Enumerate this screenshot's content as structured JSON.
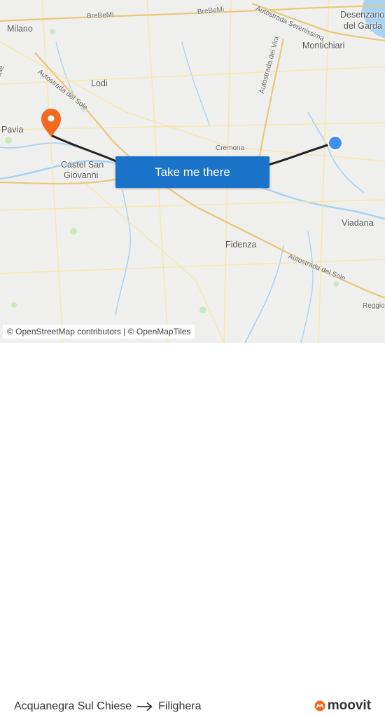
{
  "map": {
    "places": [
      {
        "name": "Milano",
        "kind": "city"
      },
      {
        "name": "Desenzano",
        "kind": "city"
      },
      {
        "name": "del Garda",
        "kind": "city"
      },
      {
        "name": "Montichiari",
        "kind": "city"
      },
      {
        "name": "Lodi",
        "kind": "city"
      },
      {
        "name": "Pavia",
        "kind": "city"
      },
      {
        "name": "Castel San",
        "kind": "city"
      },
      {
        "name": "Giovanni",
        "kind": "city"
      },
      {
        "name": "Cremona",
        "kind": "city"
      },
      {
        "name": "Viadana",
        "kind": "city"
      },
      {
        "name": "Fidenza",
        "kind": "city"
      },
      {
        "name": "Reggio",
        "kind": "city"
      }
    ],
    "roads": [
      {
        "name": "BreBeMi"
      },
      {
        "name": "BreBeMi"
      },
      {
        "name": "Autostrada Serenissima"
      },
      {
        "name": "Autostrada dei Vini"
      },
      {
        "name": "Autostrada del Sole"
      },
      {
        "name": "Autostrada del Sole"
      },
      {
        "name": "walle"
      }
    ],
    "origin_icon": "blue-location-dot-icon",
    "destination_icon": "orange-destination-pin-icon",
    "route_color": "#222222",
    "water_color": "#a9d3f2"
  },
  "cta": {
    "label": "Take me there",
    "color": "#1a73c9"
  },
  "attribution": {
    "text": "© OpenStreetMap contributors | © OpenMapTiles"
  },
  "route": {
    "from": "Acquanegra Sul Chiese",
    "to": "Filighera",
    "arrow_icon": "arrow-right-icon"
  },
  "brand": {
    "name": "moovit",
    "icon": "moovit-logo-icon",
    "color": "#f26a21"
  }
}
